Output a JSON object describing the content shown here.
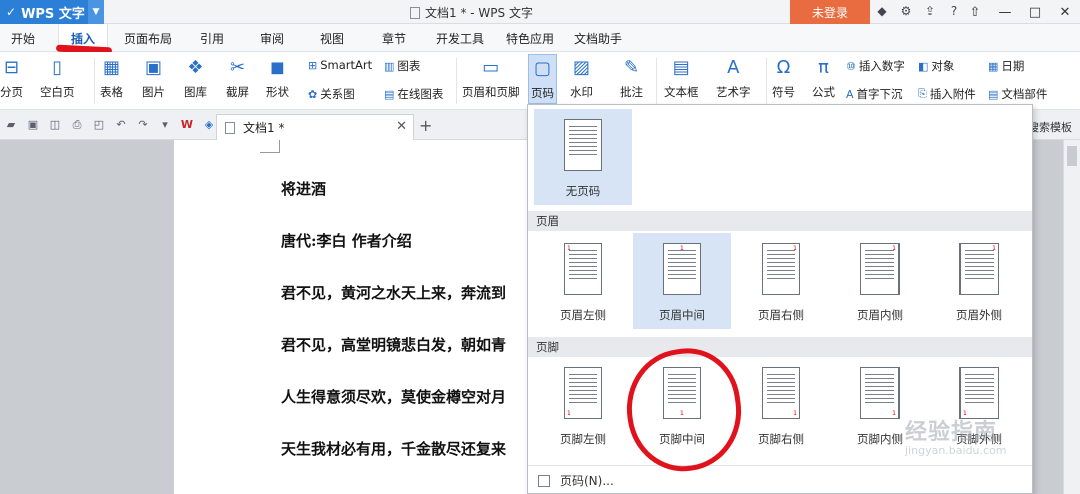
{
  "titlebar": {
    "app_name": "WPS 文字",
    "doc_title": "文档1 * - WPS 文字",
    "login": "未登录"
  },
  "menu": {
    "tabs": [
      "开始",
      "插入",
      "页面布局",
      "引用",
      "审阅",
      "视图",
      "章节",
      "开发工具",
      "特色应用",
      "文档助手"
    ],
    "active": "插入"
  },
  "ribbon": {
    "page_break": "分页",
    "blank_page": "空白页",
    "table": "表格",
    "picture": "图片",
    "gallery": "图库",
    "screenshot": "截屏",
    "shape": "形状",
    "smartart": "SmartArt",
    "chart": "图表",
    "relation": "关系图",
    "online_chart": "在线图表",
    "header_footer": "页眉和页脚",
    "page_number": "页码",
    "watermark": "水印",
    "comment": "批注",
    "textbox": "文本框",
    "wordart": "艺术字",
    "symbol": "符号",
    "formula": "公式",
    "insert_number": "插入数字",
    "object": "对象",
    "date": "日期",
    "drop_cap": "首字下沉",
    "attachment": "插入附件",
    "doc_parts": "文档部件"
  },
  "tabbar": {
    "doc_tab": "文档1 *",
    "search_template": "搜索模板"
  },
  "document": {
    "lines": [
      "将进酒",
      "唐代:李白 作者介绍",
      "君不见，黄河之水天上来，奔流到",
      "君不见，高堂明镜悲白发，朝如青",
      "人生得意须尽欢，莫使金樽空对月",
      "天生我材必有用，千金散尽还复来"
    ]
  },
  "dropdown": {
    "no_page_number": "无页码",
    "header_section": "页眉",
    "header_options": [
      "页眉左侧",
      "页眉中间",
      "页眉右侧",
      "页眉内侧",
      "页眉外侧"
    ],
    "footer_section": "页脚",
    "footer_options": [
      "页脚左侧",
      "页脚中间",
      "页脚右侧",
      "页脚内侧",
      "页脚外侧"
    ],
    "footer_item": "页码(N)...",
    "page_num_digit": "1"
  },
  "watermark": {
    "main": "经验指南",
    "sub": "jingyan.baidu.com"
  },
  "colors": {
    "accent": "#2c7fd6",
    "login": "#e96c41",
    "annotation": "#e0121b",
    "highlight": "#d6e4f6"
  }
}
